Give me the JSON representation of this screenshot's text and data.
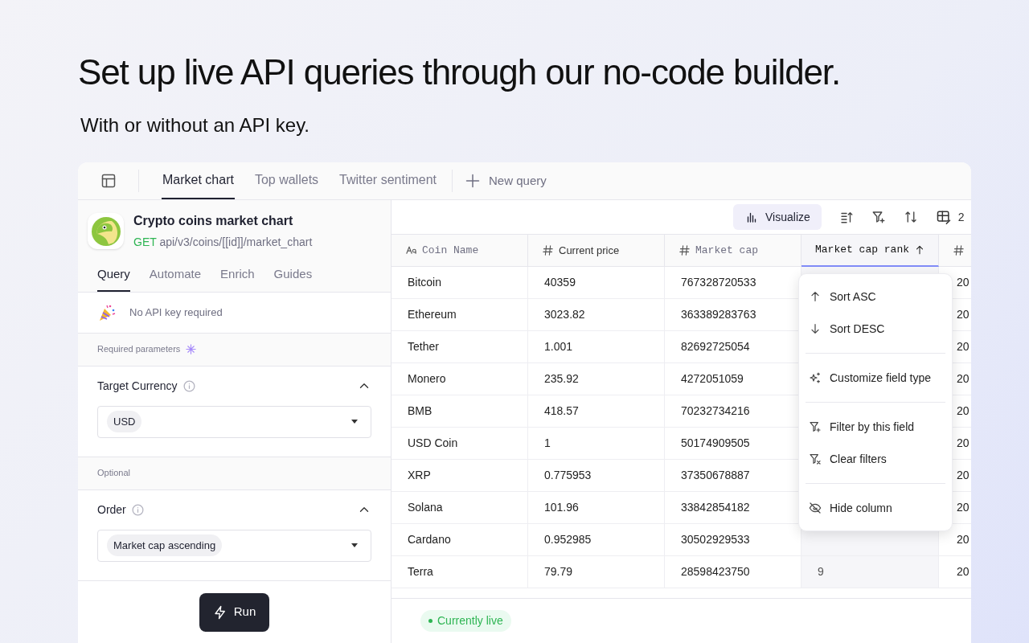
{
  "headline": "Set up live API queries through our no-code builder.",
  "subheadline": "With or without an API key.",
  "query_tabs": [
    {
      "label": "Market chart",
      "selected": true
    },
    {
      "label": "Top wallets",
      "selected": false
    },
    {
      "label": "Twitter sentiment",
      "selected": false
    }
  ],
  "new_query": "New query",
  "endpoint": {
    "title": "Crypto coins market chart",
    "method": "GET",
    "path": "api/v3/coins/[[id]]/market_chart"
  },
  "panel_tabs": [
    {
      "label": "Query",
      "selected": true
    },
    {
      "label": "Automate",
      "selected": false
    },
    {
      "label": "Enrich",
      "selected": false
    },
    {
      "label": "Guides",
      "selected": false
    }
  ],
  "api_key_note": "No API key required",
  "required_label": "Required parameters",
  "params": [
    {
      "label": "Target Currency",
      "value": "USD",
      "expanded": true
    }
  ],
  "optional_label": "Optional",
  "optional_params": [
    {
      "label": "Order",
      "value": "Market cap ascending",
      "expanded": true
    }
  ],
  "run_button": "Run",
  "toolbar": {
    "visualize": "Visualize",
    "hidden_fields": "2"
  },
  "table": {
    "columns": [
      {
        "label": "Coin Name",
        "kind": "text",
        "mono": true,
        "sorted": false
      },
      {
        "label": "Current price",
        "kind": "number",
        "mono": false,
        "sorted": false
      },
      {
        "label": "Market cap",
        "kind": "number",
        "mono": true,
        "sorted": false
      },
      {
        "label": "Market cap rank",
        "kind": "none",
        "mono": true,
        "sorted": true
      },
      {
        "kind": "number",
        "sorted": false
      }
    ],
    "rows": [
      {
        "cells": [
          "Bitcoin",
          "40359",
          "767328720533",
          "",
          "20"
        ]
      },
      {
        "cells": [
          "Ethereum",
          "3023.82",
          "363389283763",
          "",
          "20"
        ]
      },
      {
        "cells": [
          "Tether",
          "1.001",
          "82692725054",
          "",
          "20"
        ]
      },
      {
        "cells": [
          "Monero",
          "235.92",
          "4272051059",
          "",
          "20"
        ]
      },
      {
        "cells": [
          "BMB",
          "418.57",
          "70232734216",
          "",
          "20"
        ]
      },
      {
        "cells": [
          "USD Coin",
          "1",
          "50174909505",
          "",
          "20"
        ]
      },
      {
        "cells": [
          "XRP",
          "0.775953",
          "37350678887",
          "",
          "20"
        ]
      },
      {
        "cells": [
          "Solana",
          "101.96",
          "33842854182",
          "",
          "20"
        ]
      },
      {
        "cells": [
          "Cardano",
          "0.952985",
          "30502929533",
          "",
          "20"
        ]
      },
      {
        "cells": [
          "Terra",
          "79.79",
          "28598423750",
          "9",
          "20"
        ]
      }
    ]
  },
  "column_menu": [
    {
      "items": [
        {
          "kind": "sort-asc",
          "label": "Sort ASC"
        },
        {
          "kind": "sort-desc",
          "label": "Sort DESC"
        }
      ]
    },
    {
      "items": [
        {
          "kind": "customize",
          "label": "Customize field type"
        }
      ]
    },
    {
      "items": [
        {
          "kind": "filter",
          "label": "Filter by this field"
        },
        {
          "kind": "clear",
          "label": "Clear filters"
        }
      ]
    },
    {
      "items": [
        {
          "kind": "hide",
          "label": "Hide column"
        }
      ]
    }
  ],
  "status_badge": "Currently live"
}
